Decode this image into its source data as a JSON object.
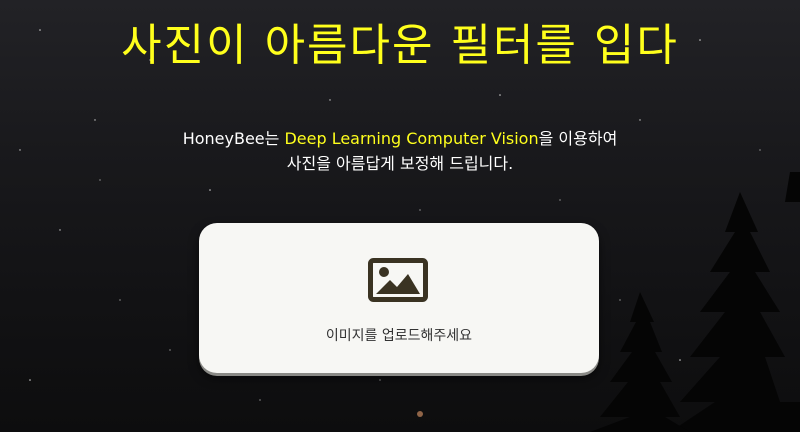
{
  "hero": {
    "title": "사진이 아름다운 필터를 입다",
    "subtitle_part1": "HoneyBee는 ",
    "subtitle_highlight": "Deep Learning Computer Vision",
    "subtitle_part2": "을 이용하여",
    "subtitle_line2": "사진을 아름답게 보정해 드립니다."
  },
  "upload": {
    "icon": "image-icon",
    "label": "이미지를 업로드해주세요"
  },
  "colors": {
    "accent": "#ffff1c",
    "card_background": "#f7f7f4",
    "icon_color": "#3a3322",
    "page_background": "#1a1a1d"
  }
}
